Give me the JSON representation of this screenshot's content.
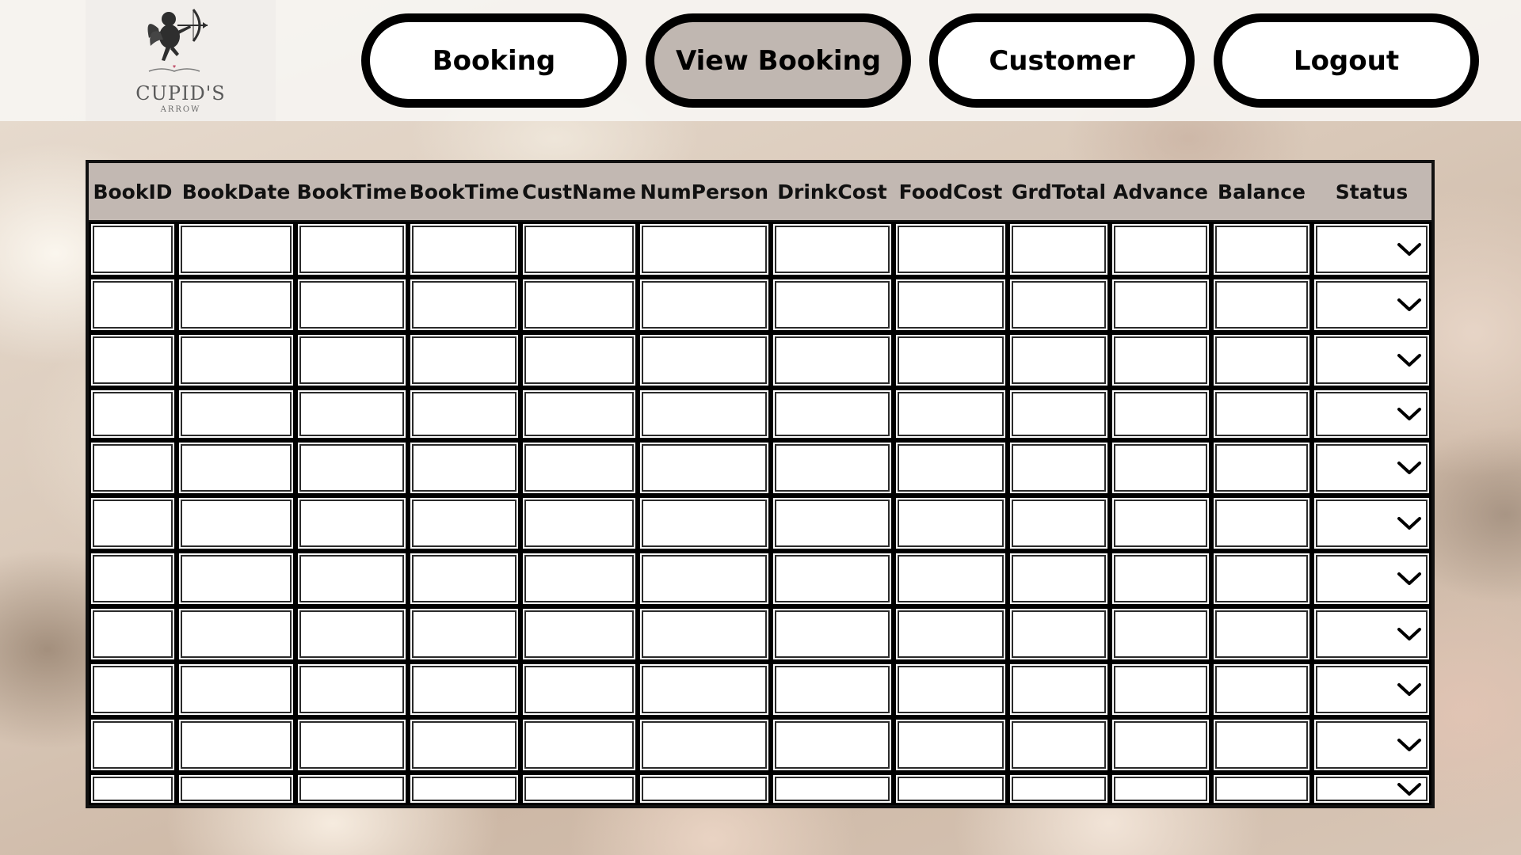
{
  "logo": {
    "title": "CUPID'S",
    "subtitle": "ARROW",
    "icon": "cupid-icon"
  },
  "nav": {
    "booking": "Booking",
    "view_booking": "View Booking",
    "customer": "Customer",
    "logout": "Logout",
    "active": "View Booking"
  },
  "table": {
    "columns": [
      "BookID",
      "BookDate",
      "BookTime",
      "BookTime",
      "CustName",
      "NumPerson",
      "DrinkCost",
      "FoodCost",
      "GrdTotal",
      "Advance",
      "Balance",
      "Status"
    ],
    "row_count": 11,
    "status_icon": "chevron-down-icon",
    "rows": []
  },
  "colors": {
    "active_button": "#c0b7b1",
    "header_row": "#c2b8b2",
    "border": "#000000"
  }
}
